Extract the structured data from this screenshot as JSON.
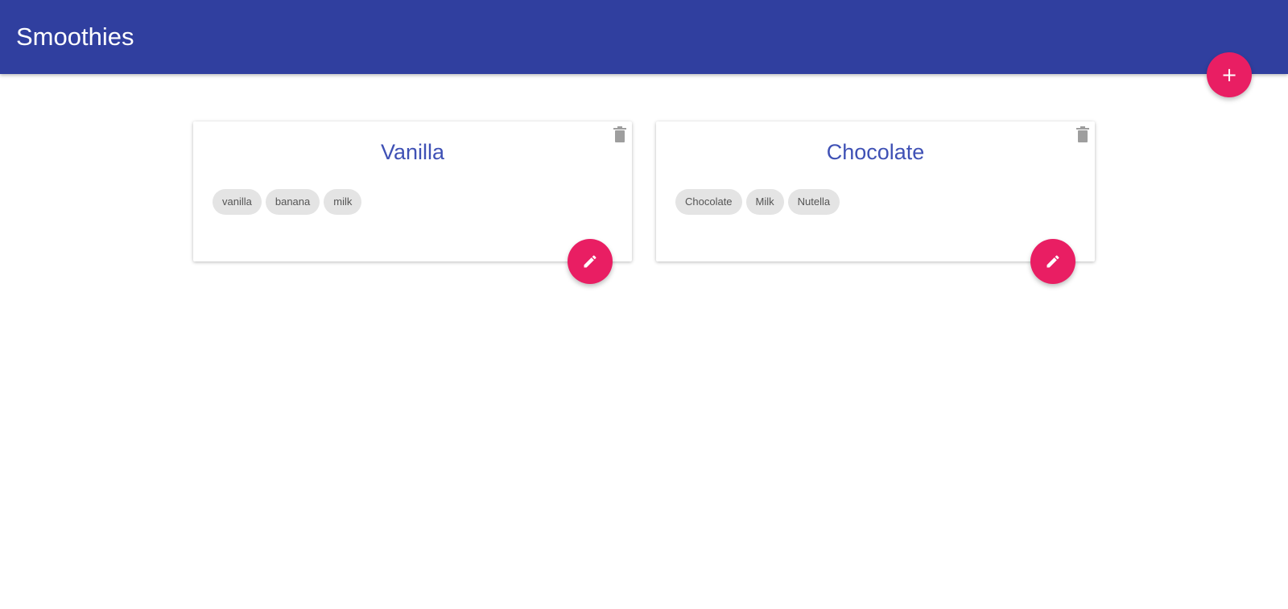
{
  "header": {
    "title": "Smoothies",
    "add_button_label": "+"
  },
  "colors": {
    "navbar": "#303f9f",
    "accent": "#e91e63",
    "title": "#3f51b5",
    "chip": "#e4e4e4"
  },
  "icons": {
    "add": "plus-icon",
    "delete": "trash-icon",
    "edit": "pencil-icon"
  },
  "smoothies": [
    {
      "title": "Vanilla",
      "ingredients": [
        "vanilla",
        "banana",
        "milk"
      ]
    },
    {
      "title": "Chocolate",
      "ingredients": [
        "Chocolate",
        "Milk",
        "Nutella"
      ]
    }
  ]
}
